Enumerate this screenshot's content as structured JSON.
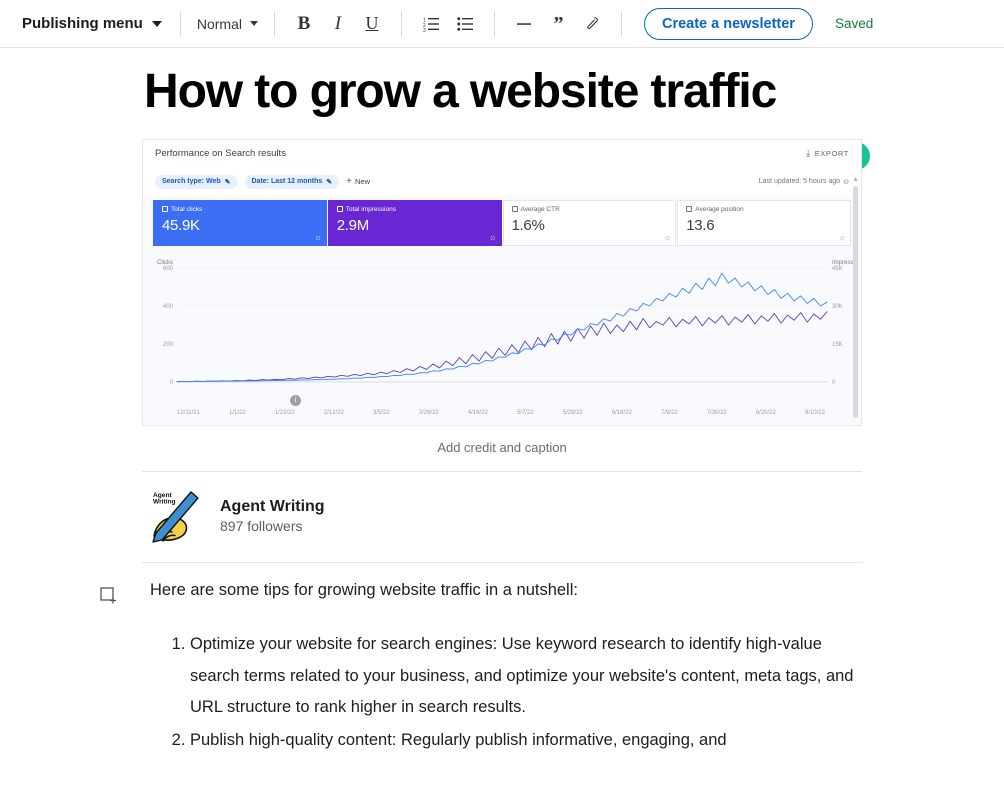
{
  "toolbar": {
    "publishing_menu": "Publishing menu",
    "style_select": "Normal",
    "bold": "B",
    "italic": "I",
    "underline": "U",
    "ordered_list_icon": "ordered-list-icon",
    "bullet_list_icon": "bullet-list-icon",
    "divider_label": "—",
    "quote_label": "”",
    "link_icon": "link-icon",
    "newsletter_button": "Create a newsletter",
    "save_status": "Saved"
  },
  "document": {
    "title": "How to grow a website traffic",
    "grammarly_badge": "G",
    "image_caption": "Add credit and caption",
    "author": {
      "name": "Agent Writing",
      "followers": "897 followers",
      "avatar_label": "Agent Writing"
    },
    "intro_paragraph": "Here are some tips for growing website traffic in a nutshell:",
    "list_items": [
      "Optimize your website for search engines: Use keyword research to identify high-value search terms related to your business, and optimize your website's content, meta tags, and URL structure to rank higher in search results.",
      "Publish high-quality content: Regularly publish informative, engaging, and"
    ]
  },
  "embedded_screenshot": {
    "header_title": "Performance on Search results",
    "export_label": "EXPORT",
    "filters": [
      {
        "label": "Search type: Web"
      },
      {
        "label": "Date: Last 12 months"
      }
    ],
    "new_filter_label": "New",
    "last_updated": "Last updated: 5 hours ago",
    "metrics": [
      {
        "label": "Total clicks",
        "value": "45.9K",
        "color": "#3b6ef5",
        "checked": true
      },
      {
        "label": "Total impressions",
        "value": "2.9M",
        "color": "#6927d3",
        "checked": true
      },
      {
        "label": "Average CTR",
        "value": "1.6%",
        "color": "#ffffff",
        "checked": false
      },
      {
        "label": "Average position",
        "value": "13.6",
        "color": "#ffffff",
        "checked": false
      }
    ],
    "tooltip_marker": "i"
  },
  "chart_data": {
    "type": "line",
    "title": "Performance on Search results",
    "xlabel": "",
    "ylabel": "Clicks",
    "y2label": "Impressions",
    "ylim": [
      0,
      600
    ],
    "y2lim": [
      0,
      45000
    ],
    "yticks": [
      "0",
      "200",
      "400",
      "600"
    ],
    "y2ticks": [
      "0",
      "15K",
      "30K",
      "45K"
    ],
    "grid": true,
    "legend_position": "none",
    "x": [
      "12/11/21",
      "1/1/22",
      "1/22/22",
      "2/12/22",
      "3/5/22",
      "3/26/22",
      "4/16/22",
      "5/7/22",
      "5/28/22",
      "6/18/22",
      "7/9/22",
      "7/30/22",
      "8/20/22",
      "9/10/22"
    ],
    "series": [
      {
        "name": "Clicks",
        "color": "#5a3ec8",
        "axis": "left",
        "values": [
          2,
          3,
          2,
          4,
          3,
          5,
          4,
          6,
          5,
          8,
          6,
          10,
          8,
          12,
          10,
          14,
          12,
          18,
          15,
          22,
          18,
          26,
          22,
          30,
          26,
          35,
          30,
          40,
          34,
          46,
          38,
          52,
          44,
          60,
          50,
          70,
          58,
          82,
          66,
          95,
          74,
          110,
          86,
          128,
          96,
          145,
          110,
          160,
          125,
          178,
          140,
          196,
          155,
          215,
          170,
          235,
          185,
          255,
          200,
          268,
          215,
          282,
          230,
          295,
          245,
          310,
          255,
          300,
          265,
          320,
          275,
          335,
          285,
          318,
          300,
          340,
          290,
          330,
          305,
          345,
          295,
          338,
          310,
          350,
          300,
          342,
          315,
          355,
          305,
          348,
          320,
          360,
          310,
          352,
          325,
          365,
          315,
          358,
          330,
          370
        ]
      },
      {
        "name": "Impressions",
        "color": "#4285f4",
        "axis": "right",
        "values": [
          150,
          200,
          180,
          250,
          220,
          300,
          280,
          350,
          320,
          400,
          380,
          460,
          440,
          520,
          500,
          600,
          580,
          700,
          660,
          820,
          780,
          950,
          900,
          1100,
          1050,
          1300,
          1250,
          1550,
          1500,
          1850,
          1800,
          2200,
          2150,
          2600,
          2550,
          3100,
          3000,
          3700,
          3600,
          4400,
          4300,
          5200,
          5100,
          6200,
          6000,
          7300,
          7100,
          8500,
          8300,
          9900,
          9700,
          11500,
          11200,
          13200,
          12900,
          15000,
          14600,
          17000,
          16500,
          19000,
          18500,
          21000,
          20500,
          23000,
          22500,
          25000,
          24000,
          27000,
          26000,
          29000,
          28000,
          31000,
          30000,
          33000,
          32000,
          35000,
          33500,
          37000,
          35000,
          39000,
          36500,
          41000,
          38000,
          43000,
          39000,
          41000,
          37500,
          39500,
          36000,
          38000,
          34500,
          36500,
          33000,
          35000,
          32000,
          34000,
          31000,
          33000,
          30000,
          31500
        ]
      }
    ]
  }
}
